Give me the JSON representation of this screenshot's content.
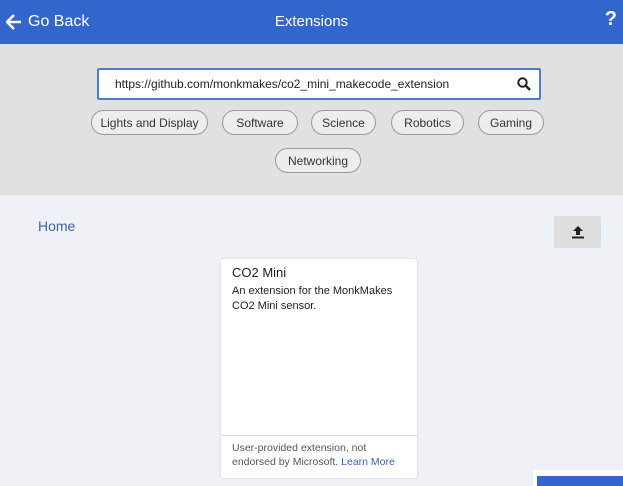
{
  "header": {
    "back_label": "Go Back",
    "title": "Extensions",
    "help_label": "?"
  },
  "search": {
    "value": "https://github.com/monkmakes/co2_mini_makecode_extension"
  },
  "categories": [
    "Lights and Display",
    "Software",
    "Science",
    "Robotics",
    "Gaming",
    "Networking"
  ],
  "breadcrumb": {
    "home_label": "Home"
  },
  "extension_card": {
    "name": "CO2 Mini",
    "description": "An extension for the MonkMakes CO2 Mini sensor.",
    "footer_note": "User-provided extension, not endorsed by Microsoft.",
    "learn_more_label": "Learn More"
  },
  "colors": {
    "header_bg": "#3366cc",
    "link": "#3d63a8"
  },
  "icons": {
    "back": "arrow-left-icon",
    "search": "search-icon",
    "upload": "upload-icon"
  }
}
